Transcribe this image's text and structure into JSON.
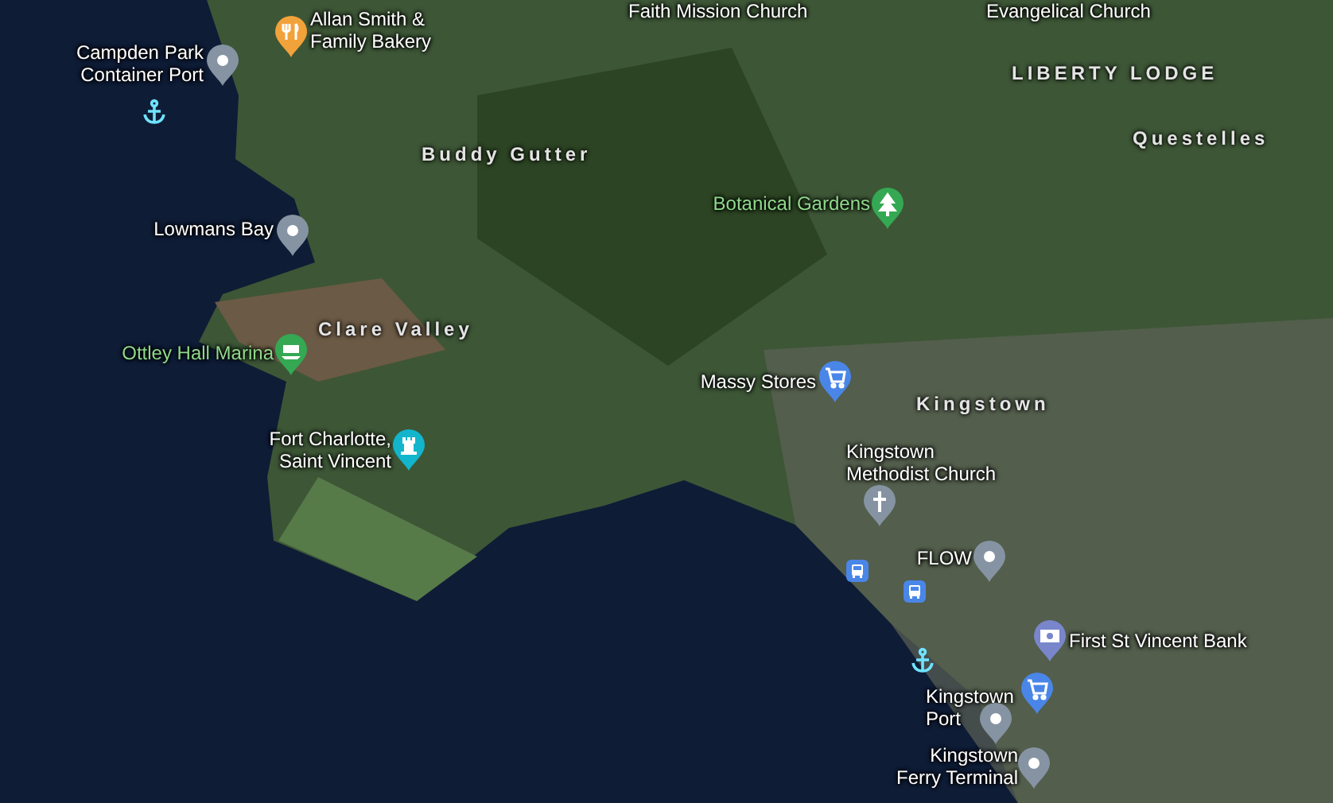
{
  "places": [
    {
      "kind": "label",
      "name": "Faith Mission Church"
    },
    {
      "kind": "label",
      "name": "Evangelical Church"
    },
    {
      "kind": "food",
      "name": "Allan Smith &\nFamily Bakery"
    },
    {
      "kind": "place",
      "name": "Campden Park\nContainer Port"
    },
    {
      "kind": "anchor"
    },
    {
      "kind": "place",
      "name": "Lowmans Bay"
    },
    {
      "kind": "park",
      "name": "Botanical Gardens"
    },
    {
      "kind": "marina",
      "name": "Ottley Hall Marina"
    },
    {
      "kind": "shop",
      "name": "Massy Stores"
    },
    {
      "kind": "castle",
      "name": "Fort Charlotte,\nSaint Vincent"
    },
    {
      "kind": "church",
      "name": "Kingstown\nMethodist Church"
    },
    {
      "kind": "place",
      "name": "FLOW"
    },
    {
      "kind": "bus"
    },
    {
      "kind": "bus"
    },
    {
      "kind": "bank",
      "name": "First St Vincent Bank"
    },
    {
      "kind": "anchor"
    },
    {
      "kind": "shop"
    },
    {
      "kind": "place",
      "name": "Kingstown\nPort"
    },
    {
      "kind": "place",
      "name": "Kingstown\nFerry Terminal"
    }
  ],
  "areas": [
    {
      "name": "LIBERTY LODGE"
    },
    {
      "name": "Buddy Gutter"
    },
    {
      "name": "Questelles"
    },
    {
      "name": "Clare Valley"
    },
    {
      "name": "Kingstown"
    }
  ]
}
